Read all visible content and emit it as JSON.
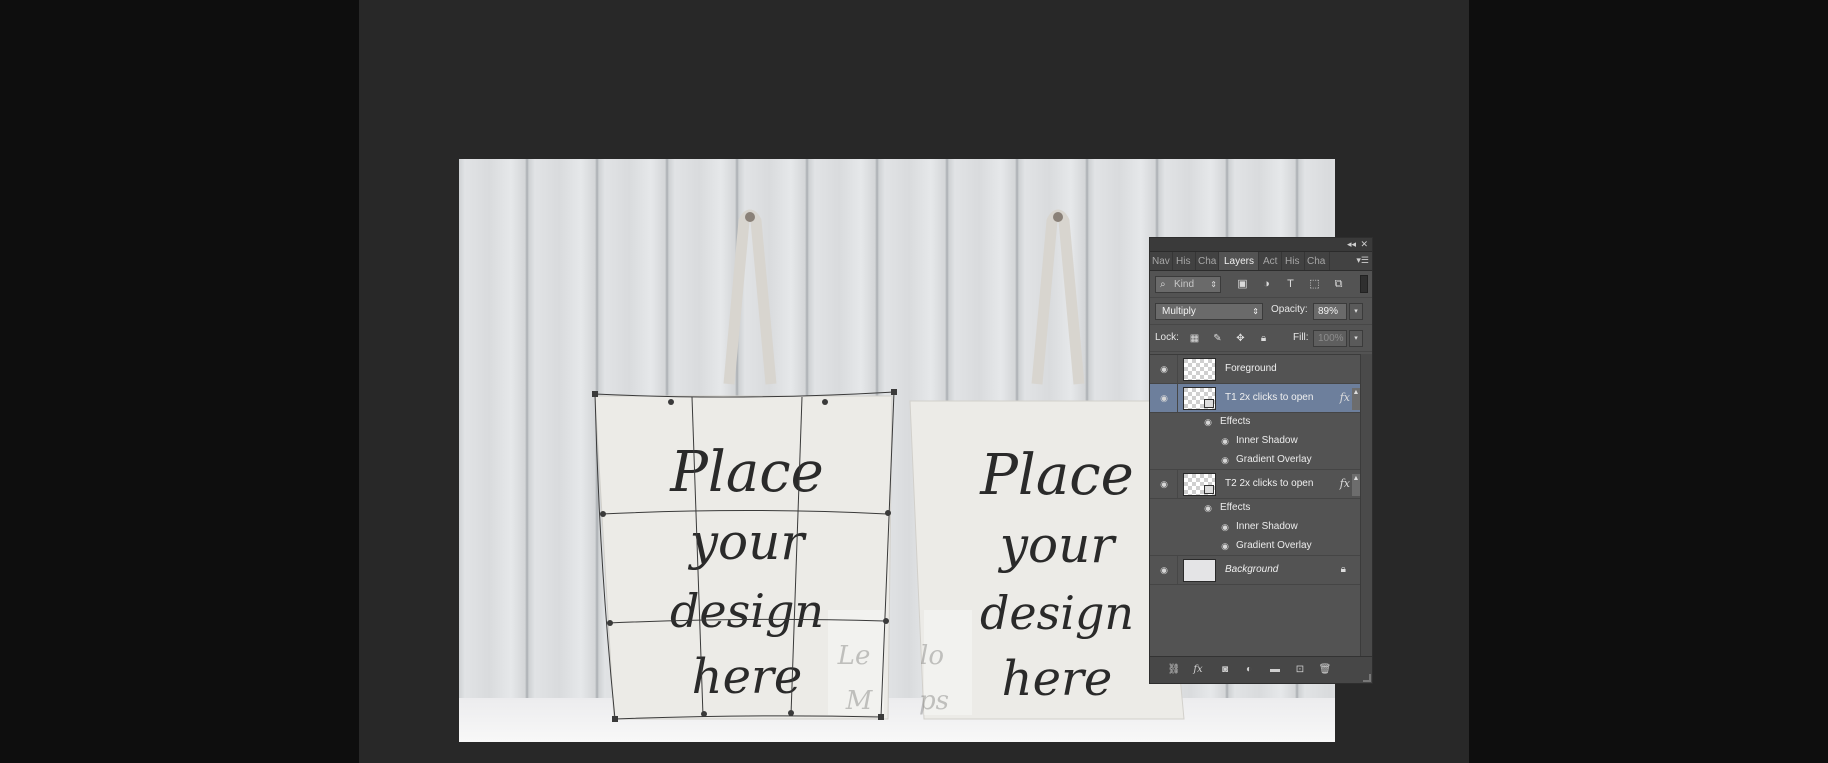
{
  "canvas": {
    "bag_left": {
      "lines": [
        "Place",
        "your",
        "design",
        "here"
      ]
    },
    "bag_right": {
      "lines": [
        "Place",
        "your",
        "design",
        "here"
      ]
    },
    "watermark": [
      "Le",
      "lo",
      "M",
      "ps"
    ]
  },
  "panel": {
    "collapse_glyph": "◂◂",
    "close_glyph": "✕",
    "tabs": [
      {
        "label": "Nav",
        "active": false
      },
      {
        "label": "His",
        "active": false
      },
      {
        "label": "Cha",
        "active": false
      },
      {
        "label": "Layers",
        "active": true
      },
      {
        "label": "Act",
        "active": false
      },
      {
        "label": "His",
        "active": false
      },
      {
        "label": "Cha",
        "active": false
      }
    ],
    "filter": {
      "label": "Kind"
    },
    "blend_mode": "Multiply",
    "opacity_label": "Opacity:",
    "opacity_value": "89%",
    "lock_label": "Lock:",
    "fill_label": "Fill:",
    "fill_value": "100%",
    "layers": [
      {
        "name": "Foreground"
      },
      {
        "name": "T1 2x clicks to open",
        "effects_label": "Effects",
        "effects": [
          "Inner Shadow",
          "Gradient Overlay"
        ]
      },
      {
        "name": "T2 2x clicks to open",
        "effects_label": "Effects",
        "effects": [
          "Inner Shadow",
          "Gradient Overlay"
        ]
      },
      {
        "name": "Background"
      }
    ],
    "fx_label": "fx"
  },
  "colors": {
    "selected_layer": "#6d7f9c",
    "panel_bg": "#535353",
    "pasteboard": "#282828"
  }
}
